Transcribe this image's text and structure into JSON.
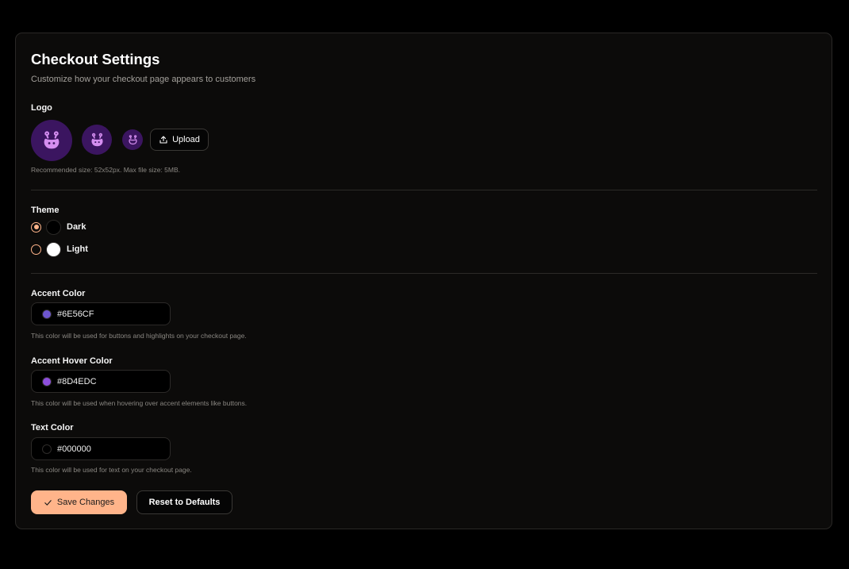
{
  "page": {
    "title": "Checkout Settings",
    "subtitle": "Customize how your checkout page appears to customers"
  },
  "logo": {
    "label": "Logo",
    "upload_label": "Upload",
    "hint": "Recommended size: 52x52px. Max file size: 5MB.",
    "icon": "hippo-mascot-icon",
    "bg_color": "#3b1560",
    "fg_color": "#d58ef0"
  },
  "theme": {
    "label": "Theme",
    "options": [
      {
        "label": "Dark",
        "selected": true,
        "swatch": "#000000"
      },
      {
        "label": "Light",
        "selected": false,
        "swatch": "#ffffff"
      }
    ]
  },
  "colors": {
    "accent": {
      "label": "Accent Color",
      "value": "#6E56CF",
      "hint": "This color will be used for buttons and highlights on your checkout page."
    },
    "accent_hover": {
      "label": "Accent Hover Color",
      "value": "#8D4EDC",
      "hint": "This color will be used when hovering over accent elements like buttons."
    },
    "text": {
      "label": "Text Color",
      "value": "#000000",
      "hint": "This color will be used for text on your checkout page."
    }
  },
  "actions": {
    "save_label": "Save Changes",
    "reset_label": "Reset to Defaults"
  },
  "style": {
    "primary_button_color": "#ffb48a",
    "background": "#000000",
    "card_background": "#0c0b0a"
  }
}
